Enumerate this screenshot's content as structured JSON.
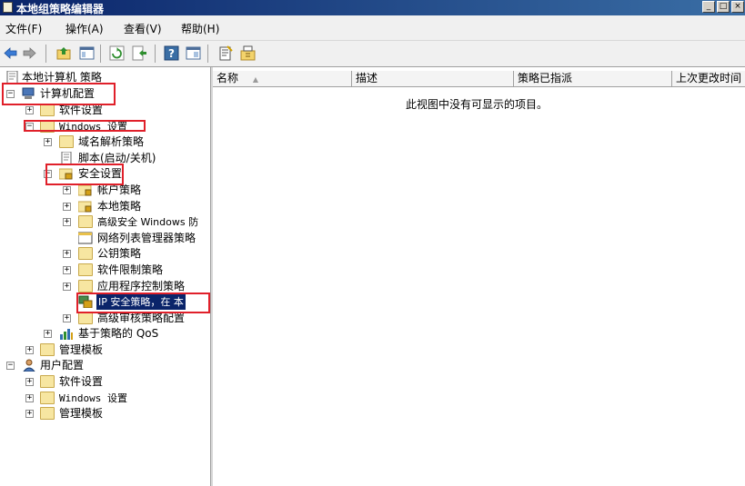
{
  "window": {
    "title": "本地组策略编辑器",
    "controls": [
      "_",
      "□",
      "×"
    ]
  },
  "menu": [
    "文件(F)",
    "操作(A)",
    "查看(V)",
    "帮助(H)"
  ],
  "toolbar": {
    "icons": [
      "back-arrow-icon",
      "forward-arrow-icon",
      "up-folder-icon",
      "show-hide-tree-icon",
      "refresh-icon",
      "export-list-icon",
      "help-icon",
      "properties-icon",
      "filter-icon",
      "policy-icon"
    ]
  },
  "tree": {
    "root": "本地计算机 策略",
    "computer_config": "计算机配置",
    "software_settings": "软件设置",
    "windows_settings": "Windows 设置",
    "dns_policy": "域名解析策略",
    "scripts": "脚本(启动/关机)",
    "security_settings": "安全设置",
    "account_policy": "帐户策略",
    "local_policy": "本地策略",
    "adv_firewall": "高级安全 Windows 防",
    "network_list": "网络列表管理器策略",
    "public_key": "公钥策略",
    "software_restriction": "软件限制策略",
    "app_control": "应用程序控制策略",
    "ip_security": "IP 安全策略，在 本",
    "adv_audit": "高级审核策略配置",
    "qos": "基于策略的 QoS",
    "admin_templates": "管理模板",
    "user_config": "用户配置",
    "user_software": "软件设置",
    "user_windows": "Windows 设置",
    "user_admin_templates": "管理模板"
  },
  "list": {
    "columns": [
      "名称",
      "描述",
      "策略已指派",
      "上次更改时间"
    ],
    "sort_indicator": "▲",
    "empty_message": "此视图中没有可显示的项目。"
  },
  "colors": {
    "selection": "#0a246a",
    "highlight_box": "#e0202a"
  }
}
